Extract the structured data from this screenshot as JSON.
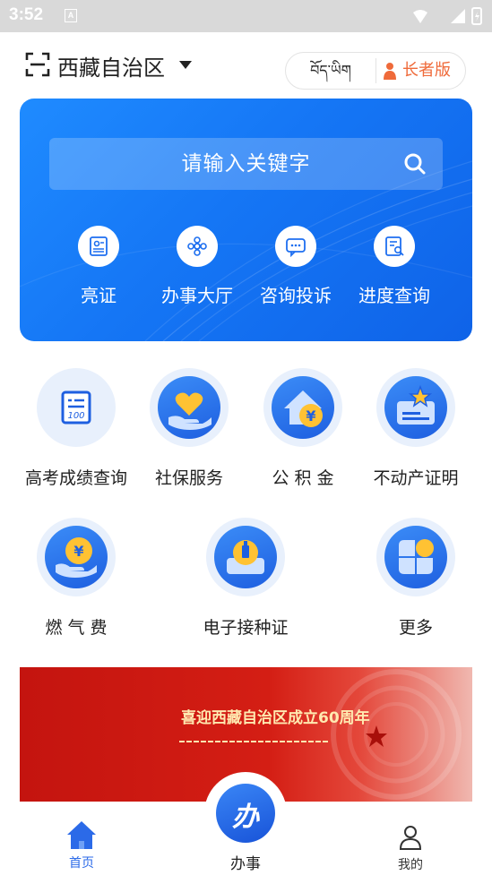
{
  "status_bar": {
    "time": "3:52",
    "notification_badge": "A"
  },
  "header": {
    "region": "西藏自治区",
    "lang_toggle": "བོད་ཡིག",
    "elder_mode": "长者版"
  },
  "search": {
    "placeholder": "请输入关键字"
  },
  "quick_actions": [
    {
      "label": "亮证",
      "icon": "id-card-icon"
    },
    {
      "label": "办事大厅",
      "icon": "flower-hall-icon"
    },
    {
      "label": "咨询投诉",
      "icon": "chat-icon"
    },
    {
      "label": "进度查询",
      "icon": "document-search-icon"
    }
  ],
  "services": [
    {
      "label": "高考成绩查询",
      "icon": "exam-score-icon"
    },
    {
      "label": "社保服务",
      "icon": "heart-hand-icon"
    },
    {
      "label": "公 积 金",
      "icon": "house-yuan-icon"
    },
    {
      "label": "不动产证明",
      "icon": "property-certificate-icon"
    },
    {
      "label": "燃 气 费",
      "icon": "gas-fee-icon"
    },
    {
      "label": "电子接种证",
      "icon": "vaccination-icon"
    },
    {
      "label": "更多",
      "icon": "more-grid-icon"
    }
  ],
  "promo": {
    "title": "喜迎西藏自治区成立60周年"
  },
  "bottom_nav": {
    "home": "首页",
    "center": "办事",
    "center_glyph": "办",
    "mine": "我的"
  },
  "colors": {
    "primary": "#1e6ff0",
    "elder_accent": "#ef6a3a",
    "promo_red": "#c4140f",
    "service_ring": "#e8f0fc"
  }
}
